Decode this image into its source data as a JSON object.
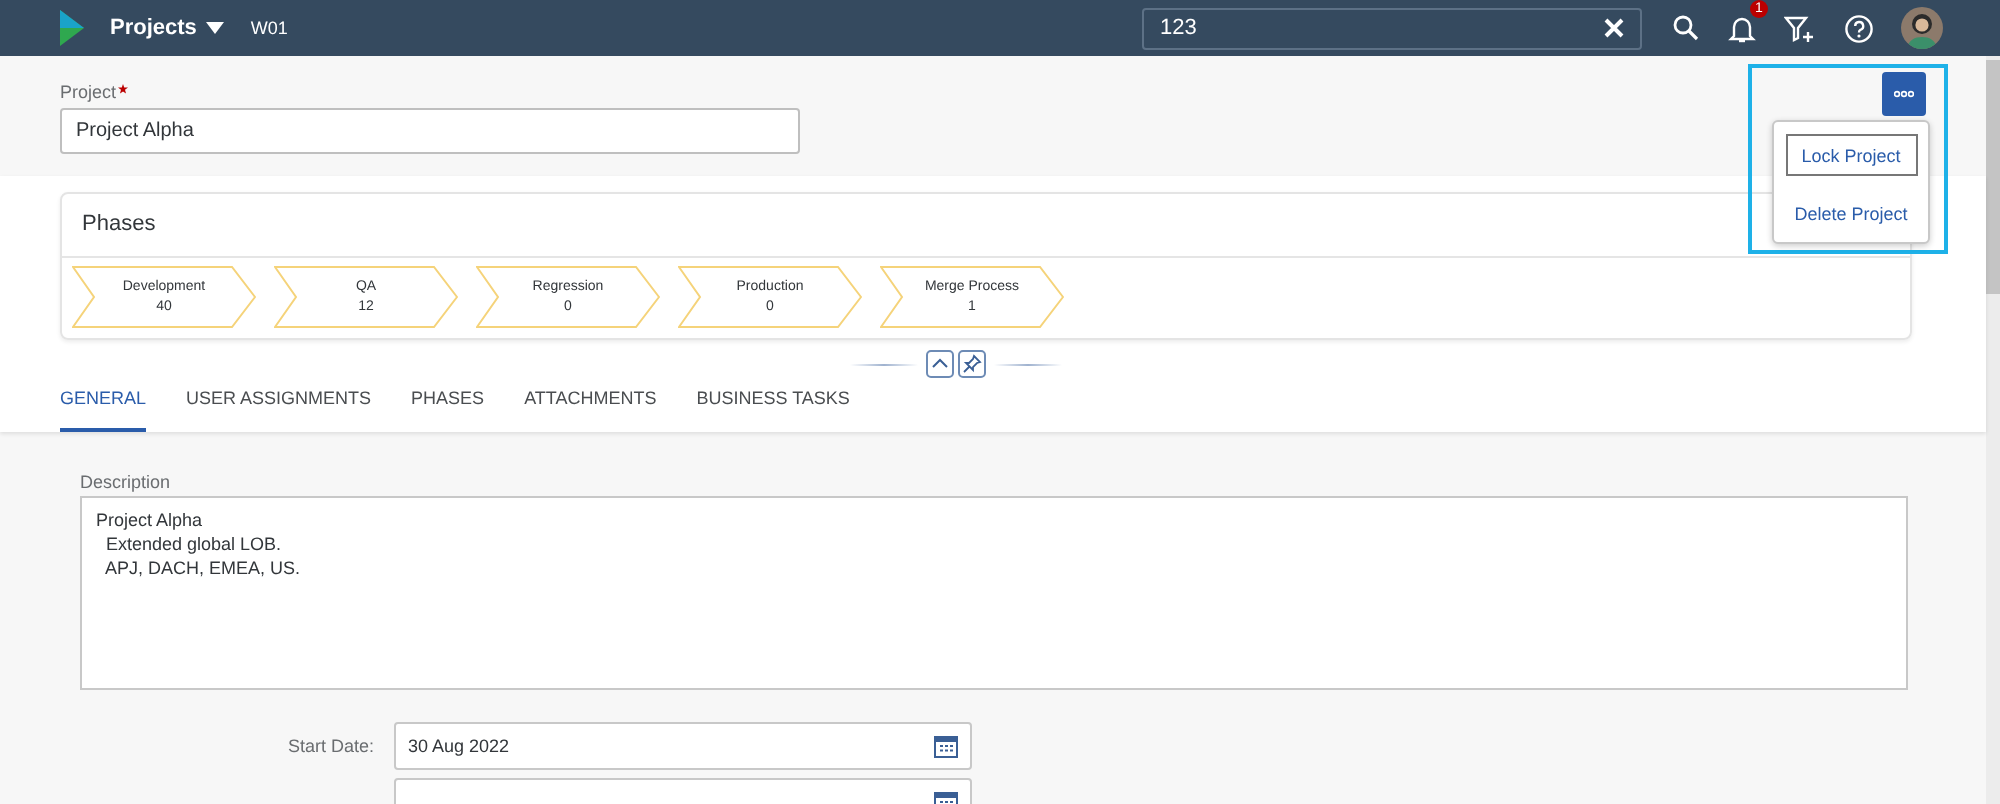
{
  "shell_bar": {
    "app_title": "Projects",
    "subtitle": "W01",
    "search": {
      "value": "123"
    },
    "notification_count": "1"
  },
  "project_field": {
    "label": "Project",
    "required": true,
    "value": "Project Alpha"
  },
  "actions_menu": {
    "open": true,
    "items": [
      {
        "label": "Lock Project",
        "focused": true
      },
      {
        "label": "Delete Project",
        "focused": false
      }
    ]
  },
  "phases": {
    "title": "Phases",
    "items": [
      {
        "name": "Development",
        "count": "40"
      },
      {
        "name": "QA",
        "count": "12"
      },
      {
        "name": "Regression",
        "count": "0"
      },
      {
        "name": "Production",
        "count": "0"
      },
      {
        "name": "Merge Process",
        "count": "1"
      }
    ]
  },
  "tabs": [
    {
      "label": "GENERAL",
      "selected": true
    },
    {
      "label": "USER ASSIGNMENTS",
      "selected": false
    },
    {
      "label": "PHASES",
      "selected": false
    },
    {
      "label": "ATTACHMENTS",
      "selected": false
    },
    {
      "label": "BUSINESS TASKS",
      "selected": false
    }
  ],
  "description": {
    "label": "Description",
    "lines": [
      "Project Alpha",
      "  Extended global LOB.",
      "  APJ, DACH, EMEA, US."
    ]
  },
  "dates": [
    {
      "label": "Start Date:",
      "value": "30 Aug 2022"
    },
    {
      "kind": "cut"
    }
  ]
}
